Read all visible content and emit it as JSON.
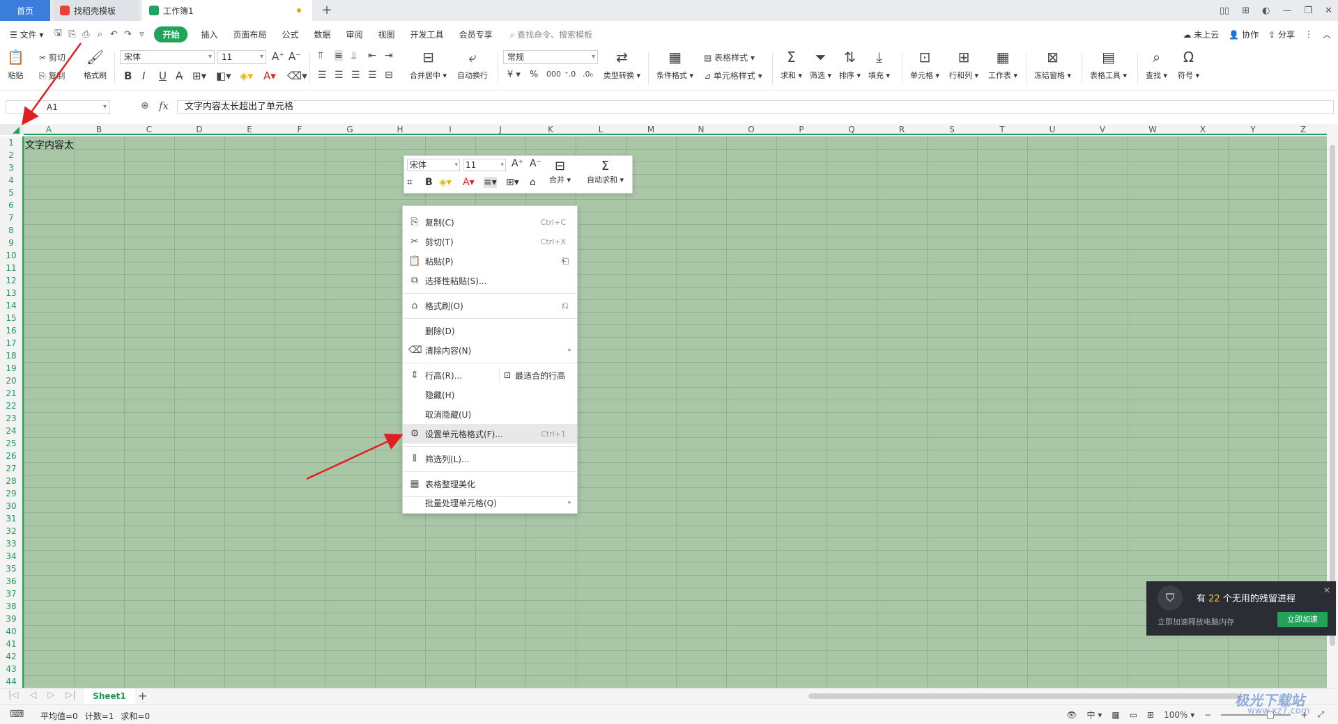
{
  "tabs": {
    "home": "首页",
    "template": "找稻壳模板",
    "workbook": "工作簿1",
    "add": "+"
  },
  "menubar": {
    "file": "文件",
    "items": [
      "开始",
      "插入",
      "页面布局",
      "公式",
      "数据",
      "审阅",
      "视图",
      "开发工具",
      "会员专享"
    ],
    "search_placeholder": "查找命令、搜索模板",
    "right": [
      "未上云",
      "协作",
      "分享"
    ]
  },
  "ribbon": {
    "paste": "粘贴",
    "cut": "剪切",
    "copy": "复制",
    "format_painter": "格式刷",
    "font_name": "宋体",
    "font_size": "11",
    "number_format": "常规",
    "merge_center": "合并居中",
    "wrap_text": "自动换行",
    "type_convert": "类型转换",
    "conditional_format": "条件格式",
    "table_style": "表格样式",
    "cell_style": "单元格样式",
    "sum": "求和",
    "filter": "筛选",
    "sort": "排序",
    "fill": "填充",
    "cell": "单元格",
    "row_col": "行和列",
    "worksheet": "工作表",
    "freeze": "冻结窗格",
    "table_tools": "表格工具",
    "find": "查找",
    "symbol": "符号",
    "currency": "¥",
    "percent": "%"
  },
  "formula_bar": {
    "name_box": "A1",
    "fx": "fx",
    "content": "文字内容太长超出了单元格"
  },
  "grid": {
    "columns": [
      "A",
      "B",
      "C",
      "D",
      "E",
      "F",
      "G",
      "H",
      "I",
      "J",
      "K",
      "L",
      "M",
      "N",
      "O",
      "P",
      "Q",
      "R",
      "S",
      "T",
      "U",
      "V",
      "W",
      "X",
      "Y",
      "Z"
    ],
    "rows": [
      "1",
      "2",
      "3",
      "4",
      "5",
      "6",
      "7",
      "8",
      "9",
      "10",
      "11",
      "12",
      "13",
      "14",
      "15",
      "16",
      "17",
      "18",
      "19",
      "20",
      "21",
      "22",
      "23",
      "24",
      "25",
      "26",
      "27",
      "28",
      "29",
      "30",
      "31",
      "32",
      "33",
      "34",
      "35",
      "36",
      "37",
      "38",
      "39",
      "40",
      "41",
      "42",
      "43",
      "44"
    ],
    "a1_value": "文字内容太"
  },
  "mini_toolbar": {
    "font_name": "宋体",
    "font_size": "11",
    "merge": "合并",
    "autosum": "自动求和"
  },
  "context_menu": {
    "copy": {
      "label": "复制(C)",
      "shortcut": "Ctrl+C"
    },
    "cut": {
      "label": "剪切(T)",
      "shortcut": "Ctrl+X"
    },
    "paste": {
      "label": "粘贴(P)"
    },
    "paste_special": {
      "label": "选择性粘贴(S)..."
    },
    "format_painter": {
      "label": "格式刷(O)"
    },
    "delete": {
      "label": "删除(D)"
    },
    "clear": {
      "label": "清除内容(N)"
    },
    "row_height": {
      "label": "行高(R)..."
    },
    "best_fit": {
      "label": "最适合的行高"
    },
    "hide": {
      "label": "隐藏(H)"
    },
    "unhide": {
      "label": "取消隐藏(U)"
    },
    "format_cells": {
      "label": "设置单元格格式(F)...",
      "shortcut": "Ctrl+1"
    },
    "filter_col": {
      "label": "筛选列(L)..."
    },
    "beautify": {
      "label": "表格整理美化"
    },
    "batch": {
      "label": "批量处理单元格(Q)"
    }
  },
  "sheets": {
    "active": "Sheet1"
  },
  "status": {
    "average": "平均值=0",
    "count": "计数=1",
    "sum": "求和=0",
    "lang": "中",
    "zoom": "100%"
  },
  "notification": {
    "prefix": "有",
    "count": "22",
    "suffix": "个无用的残留进程",
    "subtitle": "立即加速释放电脑内存",
    "button": "立即加速"
  },
  "watermark": {
    "title": "极光下载站",
    "url": "www.xz7.com"
  },
  "colors": {
    "accent_green": "#22a35a",
    "tab_blue": "#3a7ddc",
    "cell_bg": "#a9c6a6",
    "arrow_red": "#e02020"
  }
}
